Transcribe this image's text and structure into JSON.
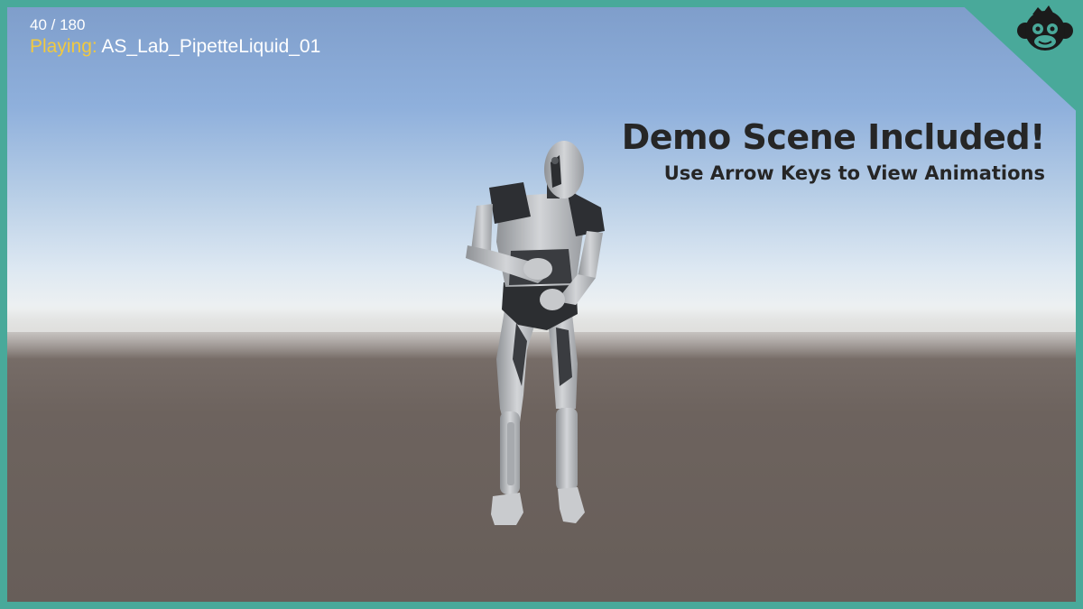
{
  "hud": {
    "frame_counter": "40 / 180",
    "playing_label": "Playing:",
    "animation_name": "AS_Lab_PipetteLiquid_01"
  },
  "banner": {
    "headline": "Demo Scene Included!",
    "subline": "Use Arrow Keys to View Animations"
  },
  "logo": {
    "icon": "monkey-head-icon"
  },
  "colors": {
    "border": "#49a99a",
    "playing_label": "#f1c940",
    "banner_text": "#262626"
  }
}
